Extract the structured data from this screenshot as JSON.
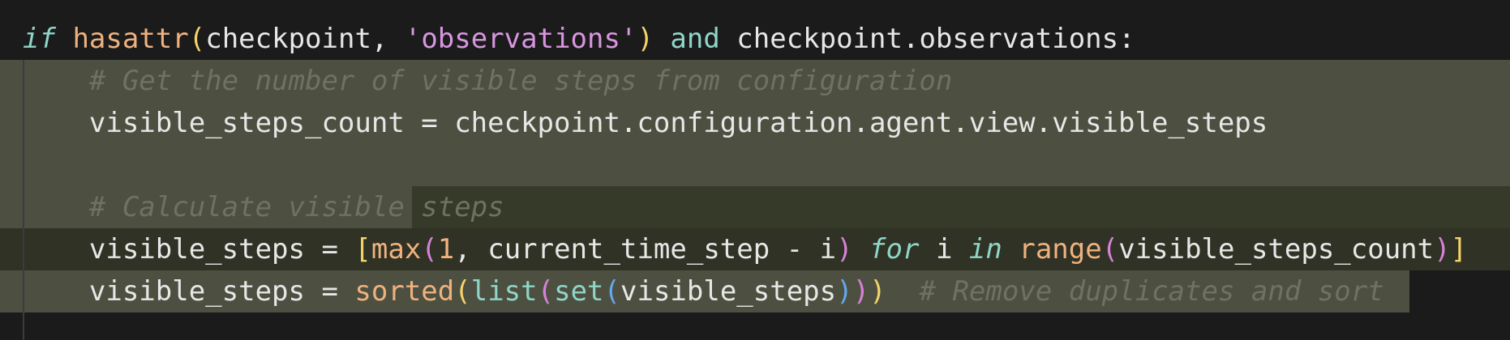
{
  "editor": {
    "lines": [
      {
        "tokens": [
          {
            "t": "if",
            "c": "kw-italic"
          },
          {
            "t": " ",
            "c": "pl"
          },
          {
            "t": "hasattr",
            "c": "fn"
          },
          {
            "t": "(",
            "c": "br1"
          },
          {
            "t": "checkpoint, ",
            "c": "pl"
          },
          {
            "t": "'observations'",
            "c": "str"
          },
          {
            "t": ")",
            "c": "br1"
          },
          {
            "t": " ",
            "c": "pl"
          },
          {
            "t": "and",
            "c": "op"
          },
          {
            "t": " checkpoint.observations:",
            "c": "pl"
          }
        ]
      },
      {
        "tokens": [
          {
            "t": "    # Get the number of visible steps from configuration",
            "c": "cm"
          }
        ]
      },
      {
        "tokens": [
          {
            "t": "    visible_steps_count = checkpoint.configuration.agent.view.visible_steps",
            "c": "pl"
          }
        ]
      },
      {
        "tokens": [
          {
            "t": "",
            "c": "pl"
          }
        ]
      },
      {
        "tokens": [
          {
            "t": "    # Calculate visible steps",
            "c": "cm"
          }
        ]
      },
      {
        "tokens": [
          {
            "t": "    visible_steps = ",
            "c": "pl"
          },
          {
            "t": "[",
            "c": "br1"
          },
          {
            "t": "max",
            "c": "fn"
          },
          {
            "t": "(",
            "c": "br2"
          },
          {
            "t": "1",
            "c": "num"
          },
          {
            "t": ", current_time_step - i",
            "c": "pl"
          },
          {
            "t": ")",
            "c": "br2"
          },
          {
            "t": " ",
            "c": "pl"
          },
          {
            "t": "for",
            "c": "kw-italic"
          },
          {
            "t": " i ",
            "c": "pl"
          },
          {
            "t": "in",
            "c": "kw-italic"
          },
          {
            "t": " ",
            "c": "pl"
          },
          {
            "t": "range",
            "c": "fn"
          },
          {
            "t": "(",
            "c": "br2"
          },
          {
            "t": "visible_steps_count",
            "c": "pl"
          },
          {
            "t": ")",
            "c": "br2"
          },
          {
            "t": "]",
            "c": "br1"
          }
        ]
      },
      {
        "tokens": [
          {
            "t": "    visible_steps = ",
            "c": "pl"
          },
          {
            "t": "sorted",
            "c": "fn"
          },
          {
            "t": "(",
            "c": "br1"
          },
          {
            "t": "list",
            "c": "bi"
          },
          {
            "t": "(",
            "c": "br2"
          },
          {
            "t": "set",
            "c": "bi"
          },
          {
            "t": "(",
            "c": "br3"
          },
          {
            "t": "visible_steps",
            "c": "pl"
          },
          {
            "t": ")",
            "c": "br3"
          },
          {
            "t": ")",
            "c": "br2"
          },
          {
            "t": ")",
            "c": "br1"
          },
          {
            "t": "  # Remove duplicates and sort",
            "c": "cm"
          }
        ]
      }
    ]
  }
}
